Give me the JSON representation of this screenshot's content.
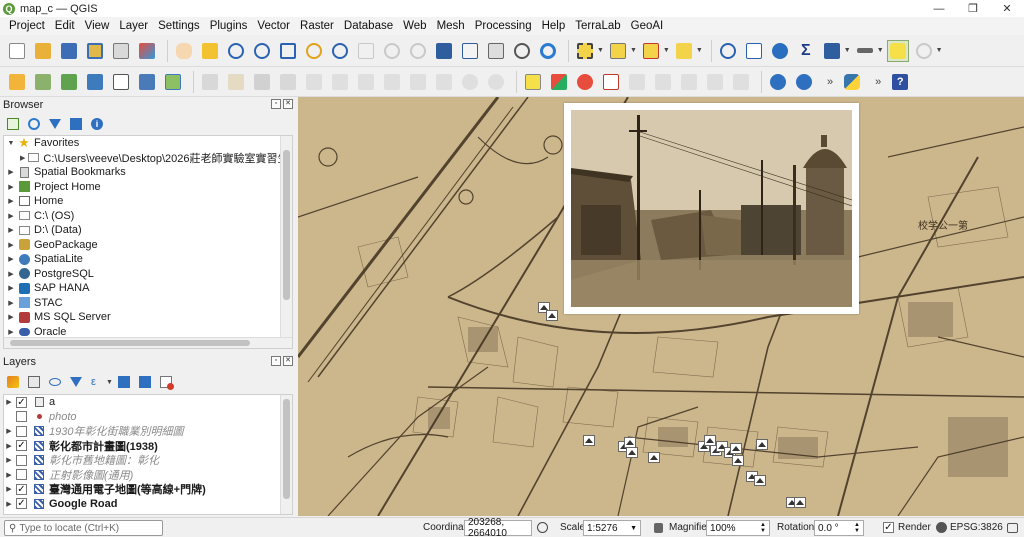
{
  "window": {
    "title": "map_c — QGIS"
  },
  "menu": [
    "Project",
    "Edit",
    "View",
    "Layer",
    "Settings",
    "Plugins",
    "Vector",
    "Raster",
    "Database",
    "Web",
    "Mesh",
    "Processing",
    "Help",
    "TerraLab",
    "GeoAI"
  ],
  "browser": {
    "title": "Browser",
    "items": [
      {
        "label": "Favorites",
        "icon": "star-icon",
        "expanded": true,
        "level": 0
      },
      {
        "label": "C:\\Users\\veeve\\Desktop\\2026莊老師實驗室實習生課程",
        "icon": "folder-icon",
        "level": 1
      },
      {
        "label": "Spatial Bookmarks",
        "icon": "bookmarks-icon",
        "level": 0
      },
      {
        "label": "Project Home",
        "icon": "project-home-icon",
        "level": 0
      },
      {
        "label": "Home",
        "icon": "home-folder-icon",
        "level": 0
      },
      {
        "label": "C:\\ (OS)",
        "icon": "drive-icon",
        "level": 0
      },
      {
        "label": "D:\\ (Data)",
        "icon": "drive-icon",
        "level": 0
      },
      {
        "label": "GeoPackage",
        "icon": "geopackage-icon",
        "level": 0
      },
      {
        "label": "SpatiaLite",
        "icon": "spatialite-icon",
        "level": 0
      },
      {
        "label": "PostgreSQL",
        "icon": "postgresql-icon",
        "level": 0
      },
      {
        "label": "SAP HANA",
        "icon": "sap-hana-icon",
        "level": 0
      },
      {
        "label": "STAC",
        "icon": "stac-icon",
        "level": 0
      },
      {
        "label": "MS SQL Server",
        "icon": "mssql-icon",
        "level": 0
      },
      {
        "label": "Oracle",
        "icon": "oracle-icon",
        "level": 0
      }
    ]
  },
  "layers": {
    "title": "Layers",
    "items": [
      {
        "label": "a",
        "checked": true,
        "style": "normal",
        "icon": "point-layer-icon"
      },
      {
        "label": "photo",
        "checked": false,
        "style": "greyed",
        "icon": "point-dot-icon"
      },
      {
        "label": "1930年彰化街職業別明細圖",
        "checked": false,
        "style": "greyed",
        "icon": "raster-icon"
      },
      {
        "label": "彰化都市計畫圖(1938)",
        "checked": true,
        "style": "bold",
        "icon": "raster-icon"
      },
      {
        "label": "彰化市舊地籍圖：彰化",
        "checked": false,
        "style": "greyed",
        "icon": "raster-icon"
      },
      {
        "label": "正射影像圖(通用)",
        "checked": false,
        "style": "greyed",
        "icon": "raster-icon"
      },
      {
        "label": "臺灣通用電子地圖(等高線+門牌)",
        "checked": true,
        "style": "bold",
        "icon": "raster-icon"
      },
      {
        "label": "Google Road",
        "checked": true,
        "style": "bold",
        "icon": "raster-icon"
      }
    ]
  },
  "statusbar": {
    "locate_placeholder": "Type to locate (Ctrl+K)",
    "coordinate_label": "Coordinate",
    "coordinate_value": "203268, 2664010",
    "scale_label": "Scale",
    "scale_value": "1:5276",
    "magnifier_label": "Magnifier",
    "magnifier_value": "100%",
    "rotation_label": "Rotation",
    "rotation_value": "0.0 °",
    "render_label": "Render",
    "render_checked": true,
    "crs_label": "EPSG:3826"
  },
  "map": {
    "layer_shown": "彰化都市計畫圖(1938)",
    "photo_popup": "historic-street-photo",
    "map_label": "校学公一第"
  },
  "colors": {
    "map_paper": "#cbb48a",
    "map_ink": "#3d2f1e",
    "photo_tone": "#a8926d",
    "accent_green": "#5b9a3a"
  }
}
